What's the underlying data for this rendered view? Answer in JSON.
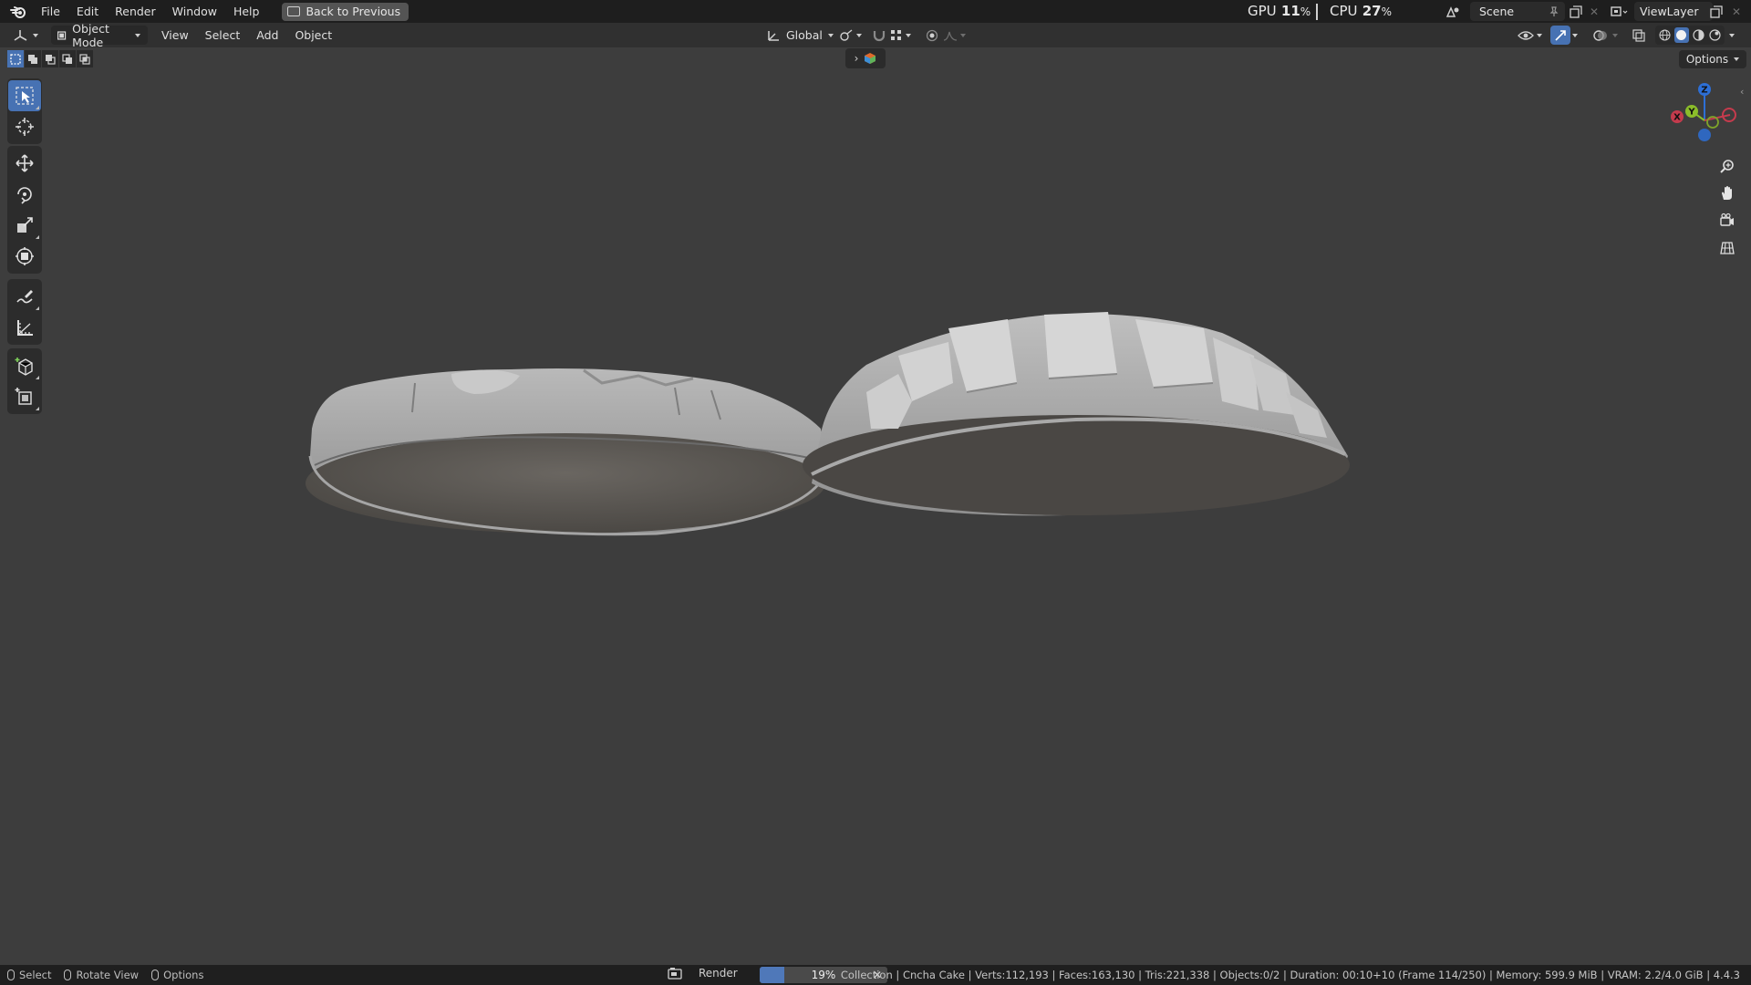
{
  "app": {
    "menu": [
      "File",
      "Edit",
      "Render",
      "Window",
      "Help"
    ],
    "back_button": "Back to Previous"
  },
  "perf": {
    "gpu_label": "GPU",
    "gpu_value": "11",
    "gpu_unit": "%",
    "cpu_label": "CPU",
    "cpu_value": "27",
    "cpu_unit": "%"
  },
  "scene": {
    "name": "Scene"
  },
  "view_layer": {
    "name": "ViewLayer"
  },
  "header": {
    "mode": "Object Mode",
    "menus": [
      "View",
      "Select",
      "Add",
      "Object"
    ],
    "transform_orientation": "Global"
  },
  "viewport": {
    "options_label": "Options",
    "gizmo_axes": {
      "z": "Z",
      "y": "Y",
      "x": "X"
    },
    "colors": {
      "x_axis": "#c53b4d",
      "y_axis": "#8bbd2a",
      "z_axis": "#2d6fd6",
      "accent": "#4772b3"
    }
  },
  "tools": [
    "select-box-icon",
    "cursor-icon",
    "move-icon",
    "rotate-icon",
    "scale-icon",
    "transform-icon",
    "annotate-icon",
    "measure-icon",
    "add-cube-icon",
    "add-object-icon"
  ],
  "status": {
    "hints": [
      "Select",
      "Rotate View",
      "Options"
    ],
    "render_label": "Render",
    "render_progress": 19,
    "render_progress_text": "19%",
    "info": "Collection | Cncha Cake | Verts:112,193 | Faces:163,130 | Tris:221,338 | Objects:0/2 | Duration: 00:10+10 (Frame 114/250) | Memory: 599.9 MiB | VRAM: 2.2/4.0 GiB | 4.4.3"
  }
}
